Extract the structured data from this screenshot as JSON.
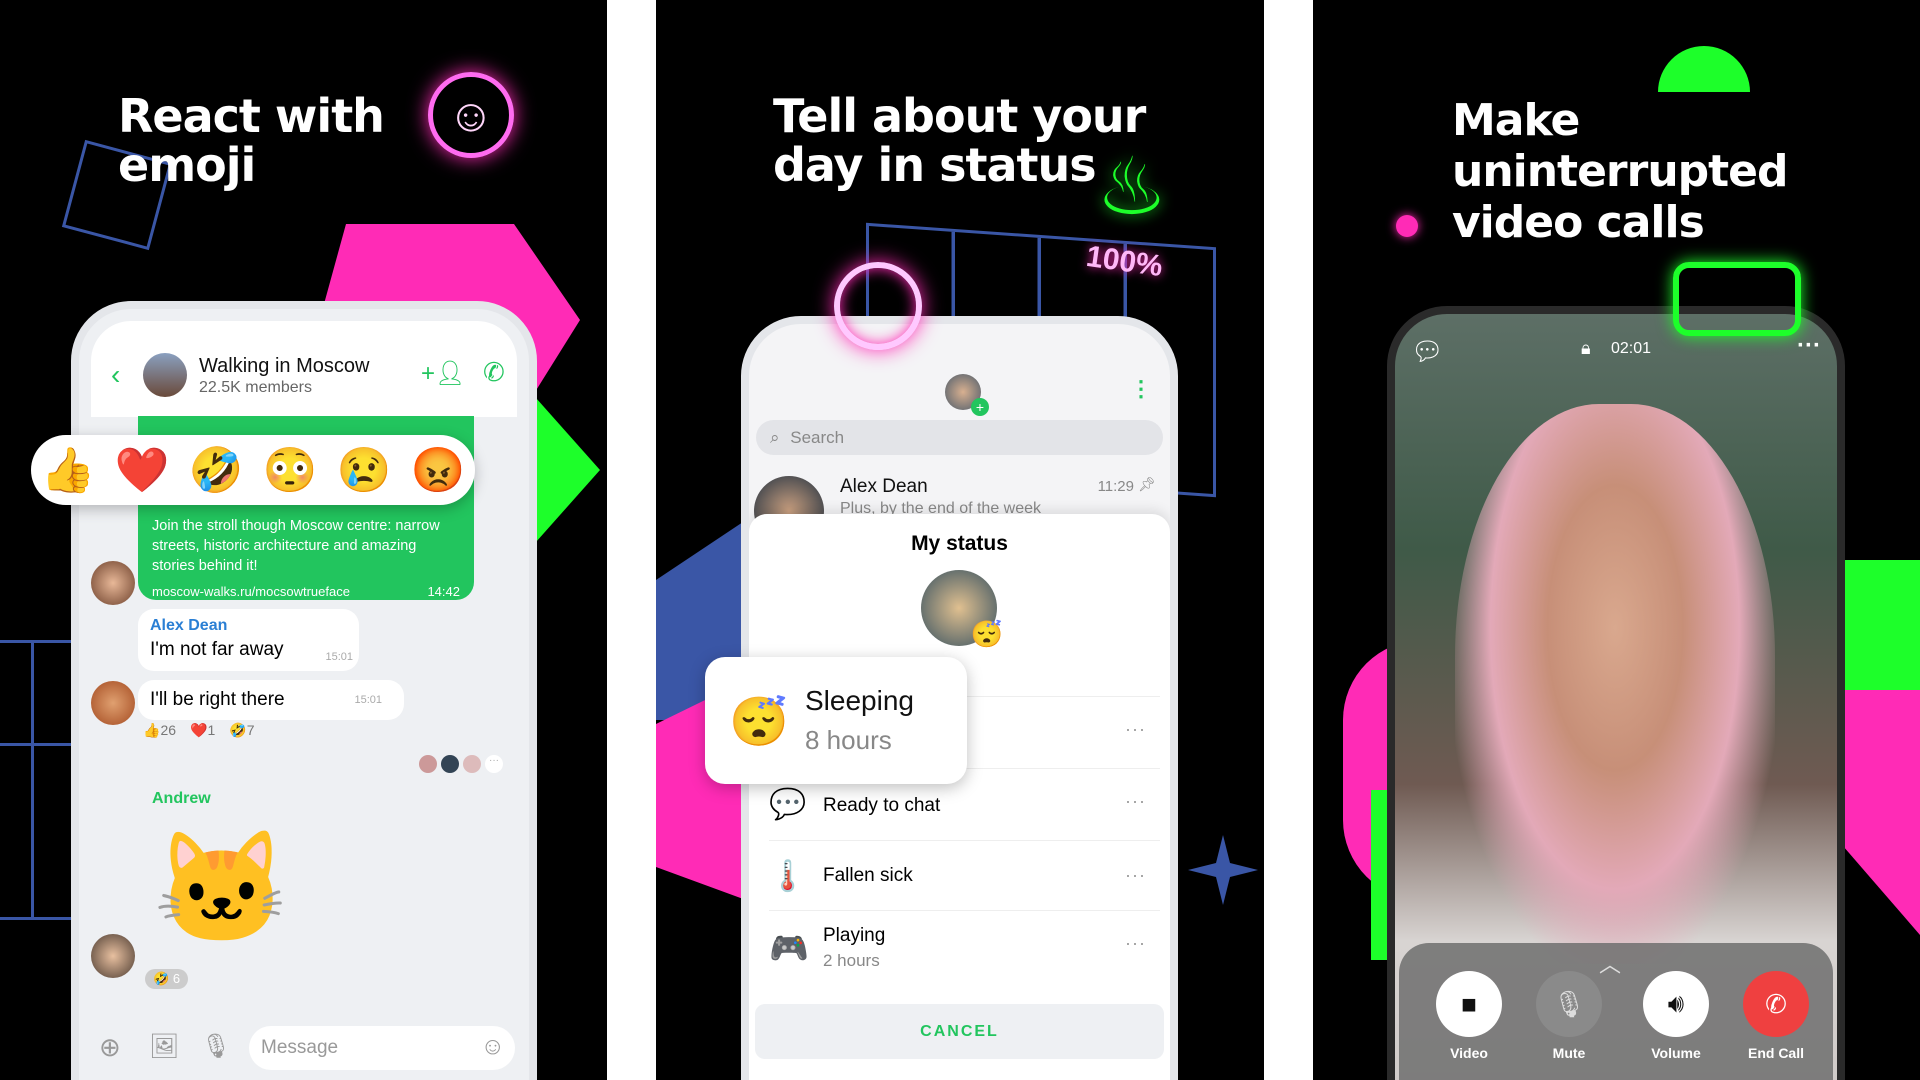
{
  "colors": {
    "green": "#22c55e",
    "neon_green": "#1dff2a",
    "pink": "#ff2bb6",
    "blue": "#3a56a6",
    "end_call": "#ef4040"
  },
  "panel1": {
    "title_line1": "React with",
    "title_line2": "emoji",
    "chat": {
      "back_icon": "chevron-left-icon",
      "name": "Walking in Moscow",
      "members": "22.5K members"
    },
    "reactions": [
      "👍",
      "❤️",
      "🤣",
      "😳",
      "😢",
      "😡"
    ],
    "link_message": {
      "text": "Join the stroll though Moscow centre: narrow streets, historic architecture and amazing stories behind it!",
      "link": "moscow-walks.ru/mocsowtrueface",
      "time": "14:42"
    },
    "message1": {
      "sender": "Alex Dean",
      "text": "I'm not far away",
      "time": "15:01"
    },
    "message2": {
      "text": "I'll be right there",
      "time": "15:01"
    },
    "reaction_counts": [
      {
        "emoji": "👍",
        "count": "26"
      },
      {
        "emoji": "❤️",
        "count": "1"
      },
      {
        "emoji": "🤣",
        "count": "7"
      }
    ],
    "sticker_sender": "Andrew",
    "sticker_reaction": {
      "emoji": "🤣",
      "count": "6"
    },
    "input_placeholder": "Message"
  },
  "panel2": {
    "title_line1": "Tell about your",
    "title_line2": "day in status",
    "badge": "100%",
    "search_placeholder": "Search",
    "chat_row": {
      "name": "Alex Dean",
      "preview": "Plus, by the end of the week",
      "time": "11:29"
    },
    "sheet_title": "My status",
    "current_status": {
      "emoji": "😴",
      "label": "Sleeping",
      "duration": "8 hours"
    },
    "statuses": [
      {
        "emoji": "💬",
        "label": "Ready to chat",
        "duration": ""
      },
      {
        "emoji": "🌡️",
        "label": "Fallen sick",
        "duration": ""
      },
      {
        "emoji": "🎮",
        "label": "Playing",
        "duration": "2 hours"
      }
    ],
    "more": "···",
    "cancel": "CANCEL"
  },
  "panel3": {
    "title_line1": "Make",
    "title_line2": "uninterrupted",
    "title_line3": "video calls",
    "timer": "02:01",
    "controls": [
      {
        "label": "Video",
        "icon": "video-camera-icon"
      },
      {
        "label": "Mute",
        "icon": "mic-off-icon"
      },
      {
        "label": "Volume",
        "icon": "speaker-icon"
      },
      {
        "label": "End Call",
        "icon": "hang-up-icon"
      }
    ]
  }
}
